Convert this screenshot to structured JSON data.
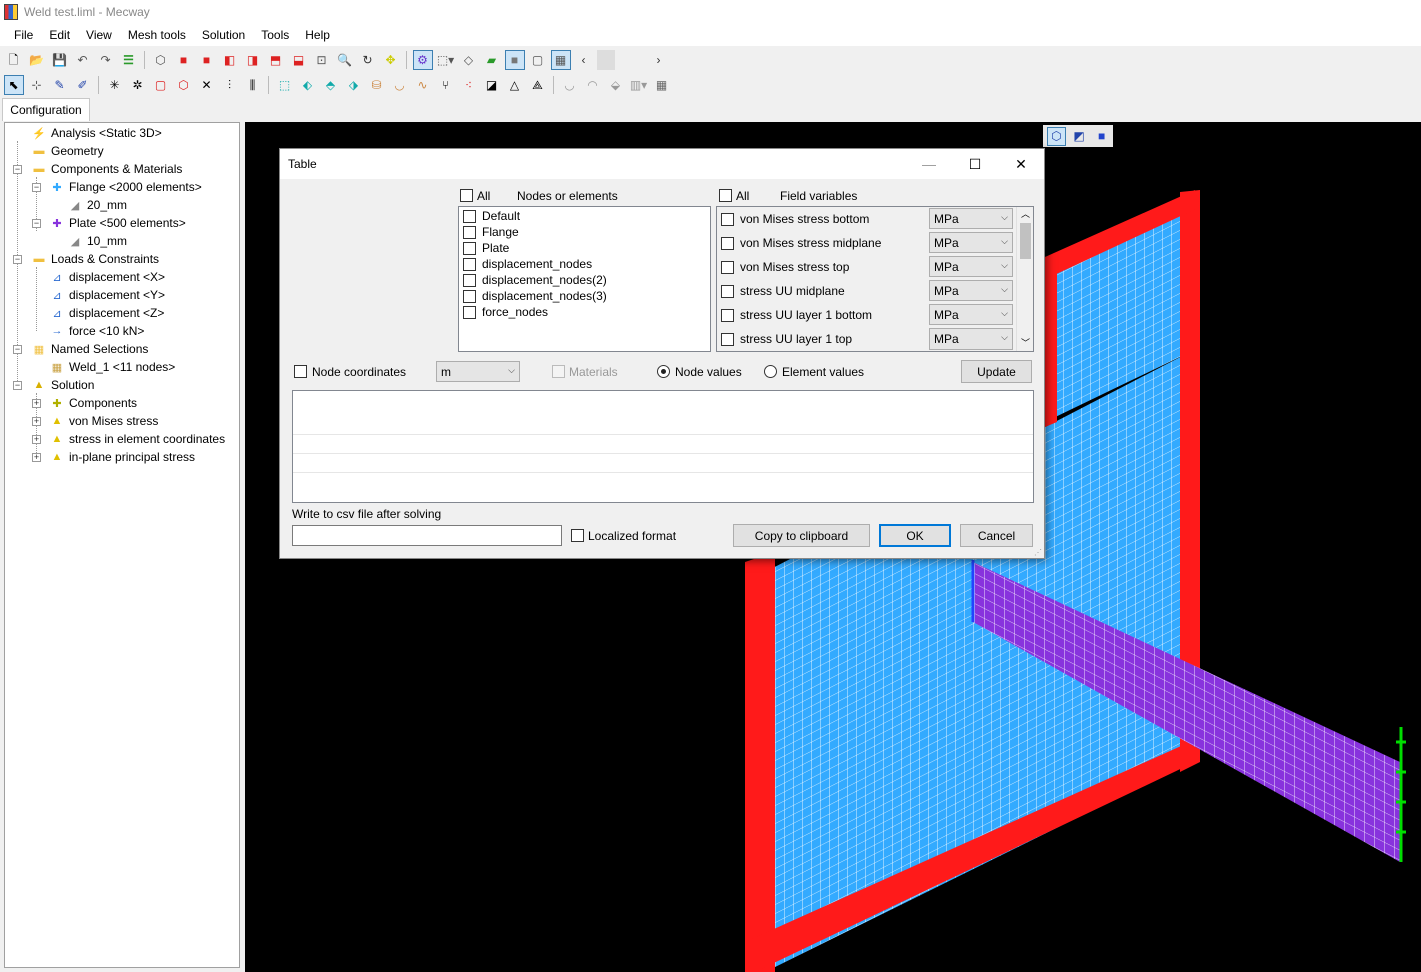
{
  "window": {
    "title": "Weld test.liml - Mecway"
  },
  "menu": [
    "File",
    "Edit",
    "View",
    "Mesh tools",
    "Solution",
    "Tools",
    "Help"
  ],
  "tabs": {
    "configuration": "Configuration"
  },
  "tree": [
    {
      "label": "Analysis <Static 3D>",
      "icon": "analysis-icon"
    },
    {
      "label": "Geometry",
      "icon": "folder-icon"
    },
    {
      "label": "Components & Materials",
      "icon": "components-folder-icon"
    },
    {
      "label": "Flange <2000 elements>",
      "icon": "component-icon"
    },
    {
      "label": "20_mm",
      "icon": "thickness-icon"
    },
    {
      "label": "Plate <500 elements>",
      "icon": "component-icon"
    },
    {
      "label": "10_mm",
      "icon": "thickness-icon"
    },
    {
      "label": "Loads & Constraints",
      "icon": "loads-folder-icon"
    },
    {
      "label": "displacement <X>",
      "icon": "displacement-icon"
    },
    {
      "label": "displacement <Y>",
      "icon": "displacement-icon"
    },
    {
      "label": "displacement <Z>",
      "icon": "displacement-icon"
    },
    {
      "label": "force <10 kN>",
      "icon": "force-icon"
    },
    {
      "label": "Named Selections",
      "icon": "selections-folder-icon"
    },
    {
      "label": "Weld_1 <11 nodes>",
      "icon": "selection-icon"
    },
    {
      "label": "Solution",
      "icon": "solution-icon"
    },
    {
      "label": "Components",
      "icon": "components-icon"
    },
    {
      "label": "von Mises stress",
      "icon": "result-icon"
    },
    {
      "label": "stress in element coordinates",
      "icon": "result-icon"
    },
    {
      "label": "in-plane principal stress",
      "icon": "result-icon"
    }
  ],
  "dialog": {
    "title": "Table",
    "nodes_header": "Nodes or elements",
    "all_label": "All",
    "fields_header": "Field variables",
    "nodes": [
      "Default",
      "Flange",
      "Plate",
      "displacement_nodes",
      "displacement_nodes(2)",
      "displacement_nodes(3)",
      "force_nodes"
    ],
    "fields": [
      {
        "name": "von Mises stress bottom",
        "unit": "MPa"
      },
      {
        "name": "von Mises stress midplane",
        "unit": "MPa"
      },
      {
        "name": "von Mises stress top",
        "unit": "MPa"
      },
      {
        "name": "stress UU midplane",
        "unit": "MPa"
      },
      {
        "name": "stress UU layer 1 bottom",
        "unit": "MPa"
      },
      {
        "name": "stress UU layer 1 top",
        "unit": "MPa"
      }
    ],
    "node_coordinates": "Node coordinates",
    "coord_unit": "m",
    "materials": "Materials",
    "node_values": "Node values",
    "element_values": "Element values",
    "update": "Update",
    "csv_label": "Write to csv file after solving",
    "csv_value": "",
    "localized": "Localized format",
    "copy": "Copy to clipboard",
    "ok": "OK",
    "cancel": "Cancel"
  },
  "colors": {
    "flange": "#33aaff",
    "flange_edge": "#ff0000",
    "plate": "#8833dd",
    "force_arrow": "#00dd00",
    "background": "#000000"
  }
}
